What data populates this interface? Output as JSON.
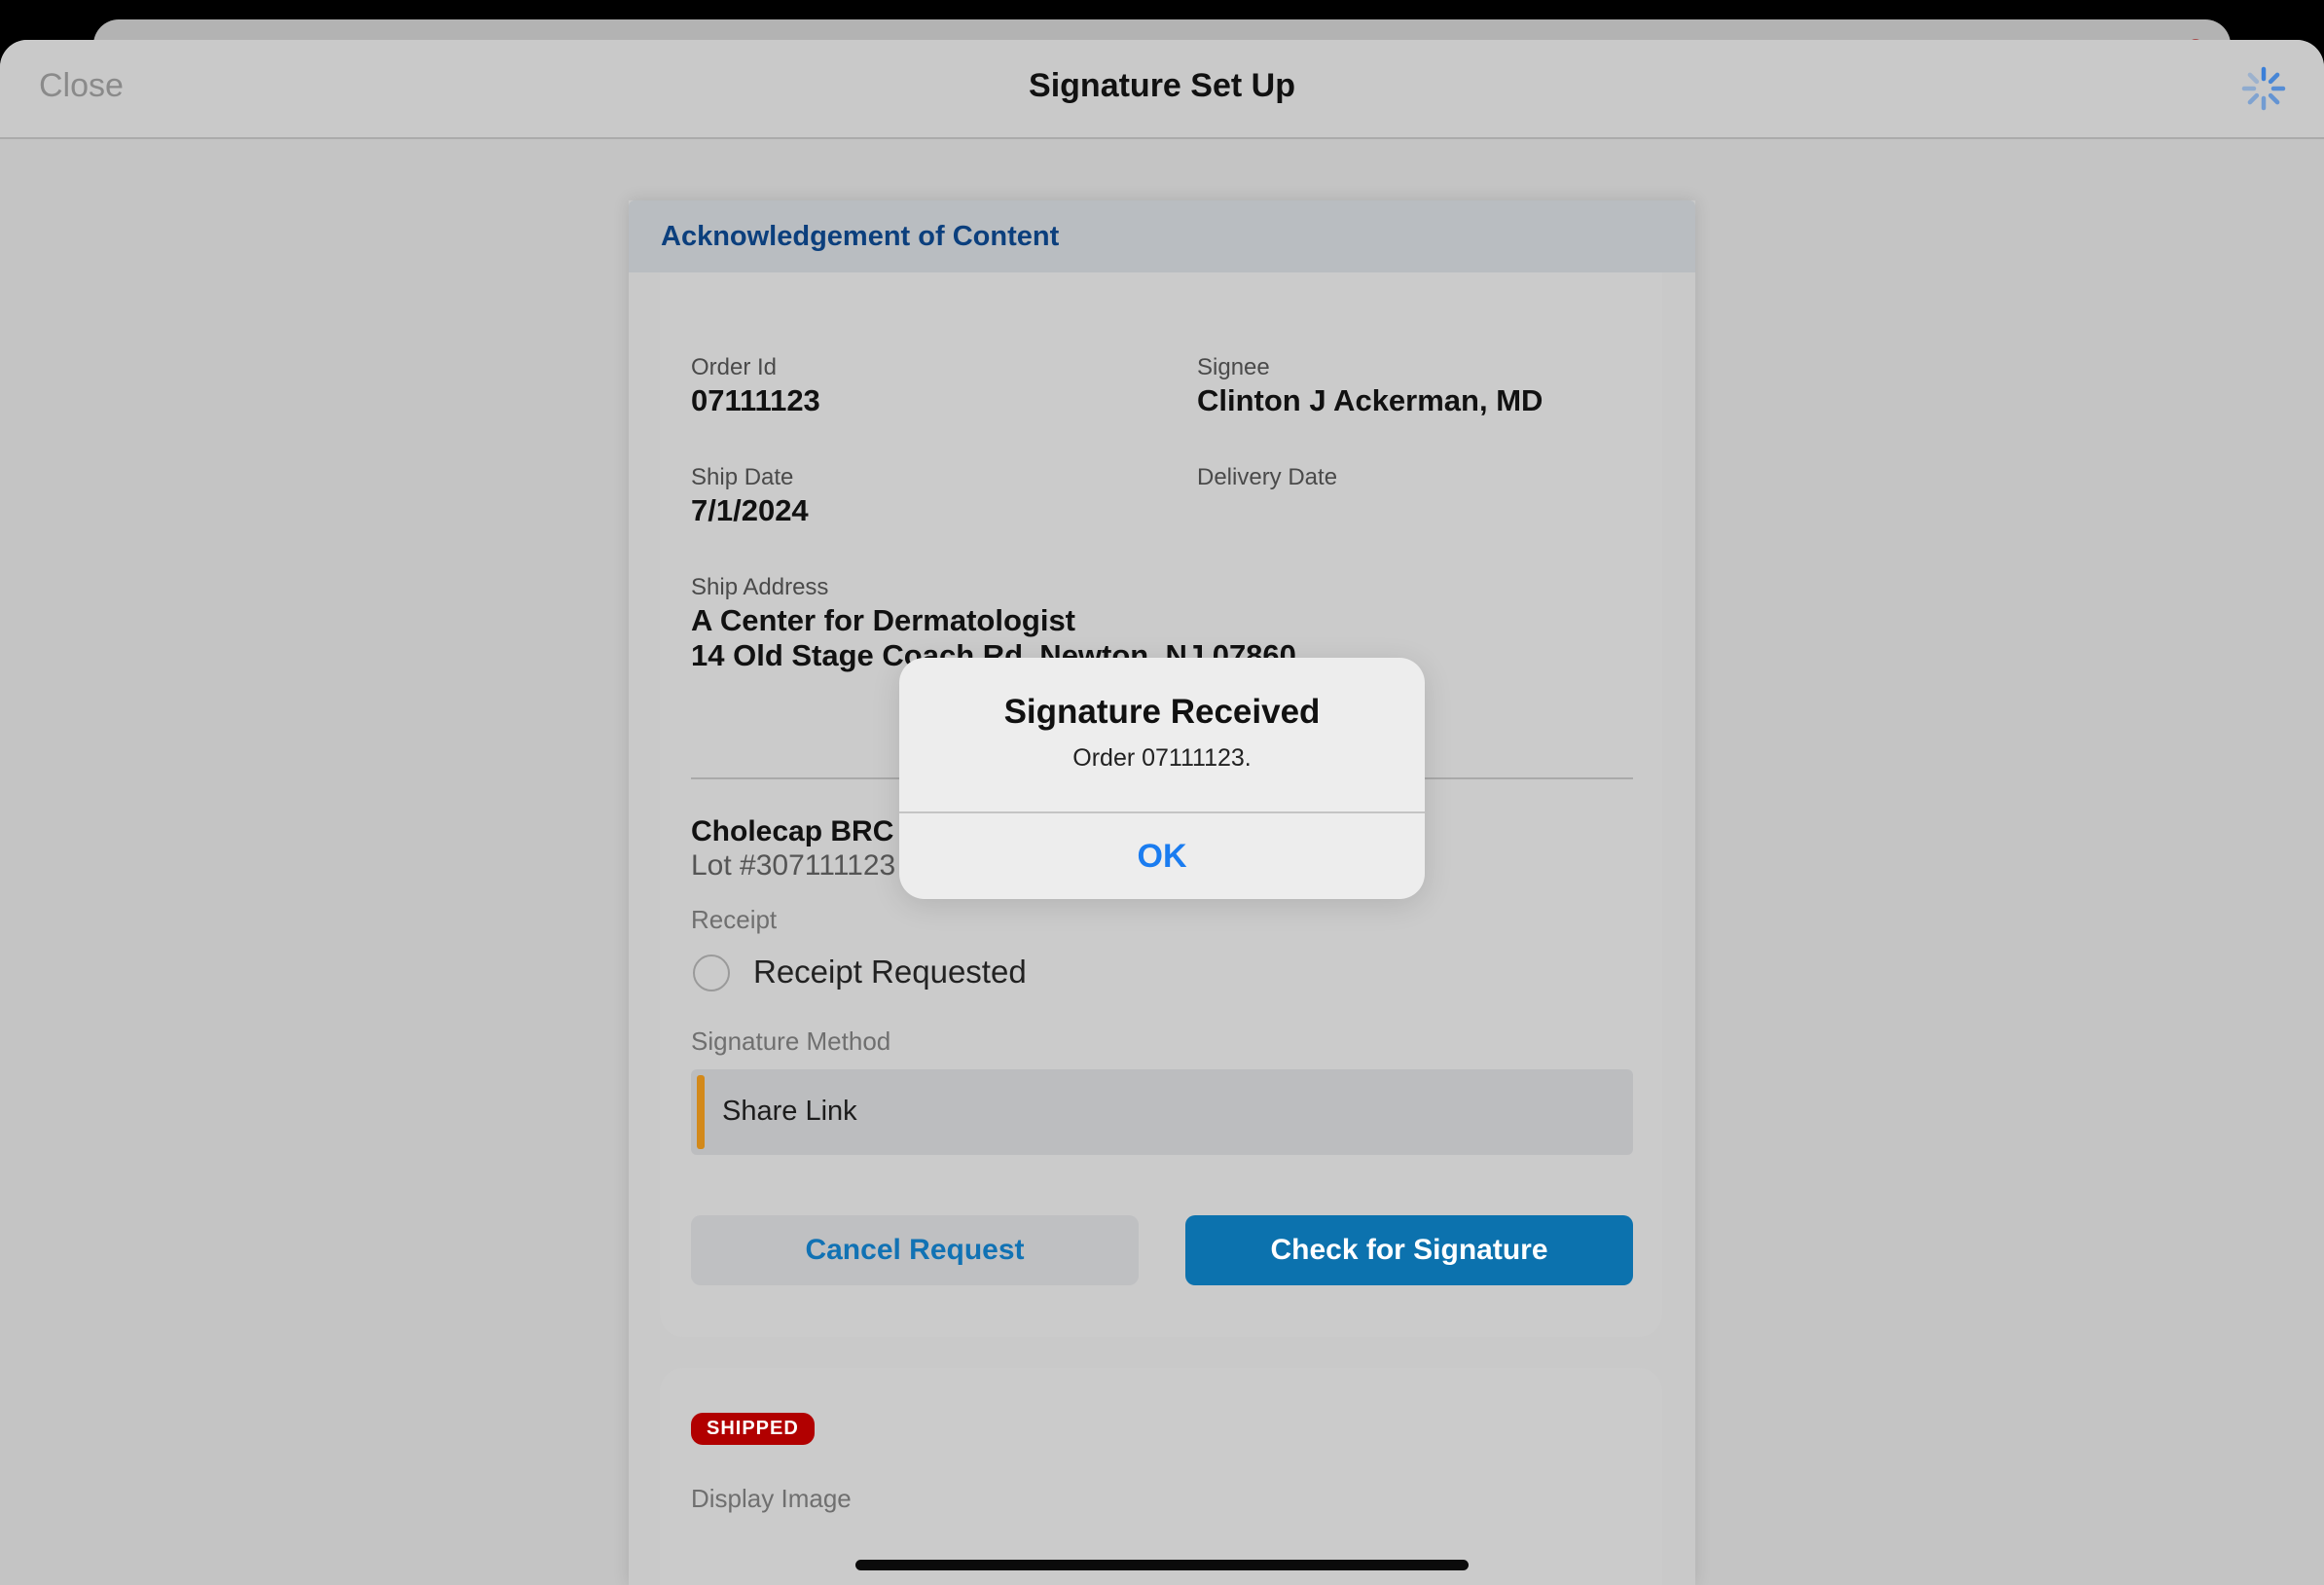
{
  "nav": {
    "close_label": "Close",
    "title": "Signature Set Up"
  },
  "card": {
    "title": "Acknowledgement of Content",
    "order_id_label": "Order Id",
    "order_id": "07111123",
    "signee_label": "Signee",
    "signee": "Clinton J Ackerman, MD",
    "ship_date_label": "Ship Date",
    "ship_date": "7/1/2024",
    "delivery_date_label": "Delivery Date",
    "ship_address_label": "Ship Address",
    "ship_address_line1": "A Center for Dermatologist",
    "ship_address_line2": "14 Old Stage Coach Rd. Newton, NJ 07860",
    "product_name": "Cholecap BRC 1",
    "lot": "Lot #307111123",
    "receipt_label": "Receipt",
    "receipt_option": "Receipt Requested",
    "signature_method_label": "Signature Method",
    "signature_method": "Share Link",
    "cancel_button": "Cancel Request",
    "check_button": "Check for Signature"
  },
  "card2": {
    "status_badge": "SHIPPED",
    "display_image_label": "Display Image"
  },
  "alert": {
    "title": "Signature Received",
    "message": "Order 07111123.",
    "ok_label": "OK"
  },
  "colors": {
    "accent": "#0c72ae",
    "link": "#1a7cf0",
    "badge": "#b10000",
    "method_marker": "#d3891a",
    "header_text": "#0b3f7d"
  },
  "icons": {
    "spinner": "loading-spinner-icon"
  }
}
